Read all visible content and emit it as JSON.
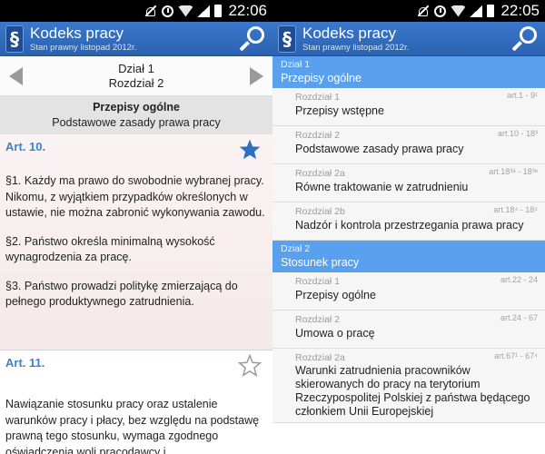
{
  "left": {
    "status_time": "22:06",
    "app": {
      "title": "Kodeks pracy",
      "subtitle": "Stan prawny listopad 2012r.",
      "logo_glyph": "§"
    },
    "division_nav": {
      "division": "Dział 1",
      "chapter": "Rozdział 2"
    },
    "section": {
      "title": "Przepisy ogólne",
      "description": "Podstawowe zasady prawa pracy"
    },
    "articles": [
      {
        "number": "Art. 10.",
        "favorite": true,
        "paragraphs": [
          "§1. Każdy ma prawo do swobodnie wybranej pracy. Nikomu, z wyjątkiem przypadków określonych w ustawie, nie można zabronić wykonywania zawodu.",
          "§2. Państwo określa minimalną wysokość wynagrodzenia za pracę.",
          "§3. Państwo prowadzi politykę zmierzającą do pełnego produktywnego zatrudnienia."
        ]
      },
      {
        "number": "Art. 11.",
        "favorite": false,
        "paragraphs": [
          "Nawiązanie stosunku pracy oraz ustalenie warunków pracy i płacy, bez względu na podstawę prawną tego stosunku, wymaga zgodnego oświadczenia woli pracodawcy i"
        ]
      }
    ]
  },
  "right": {
    "status_time": "22:05",
    "app": {
      "title": "Kodeks pracy",
      "subtitle": "Stan prawny listopad 2012r.",
      "logo_glyph": "§"
    },
    "divisions": [
      {
        "label": "Dział 1",
        "name": "Przepisy ogólne",
        "chapters": [
          {
            "label": "Rozdział 1",
            "name": "Przepisy wstępne",
            "range": "art.1 - 9¹"
          },
          {
            "label": "Rozdział 2",
            "name": "Podstawowe zasady prawa pracy",
            "range": "art.10 - 18³"
          },
          {
            "label": "Rozdział 2a",
            "name": "Równe traktowanie w zatrudnieniu",
            "range": "art.18³ᵃ - 18³ᵉ"
          },
          {
            "label": "Rozdział 2b",
            "name": "Nadzór i kontrola przestrzegania prawa pracy",
            "range": "art.18⁴ - 18⁵"
          }
        ]
      },
      {
        "label": "Dział 2",
        "name": "Stosunek pracy",
        "chapters": [
          {
            "label": "Rozdział 1",
            "name": "Przepisy ogólne",
            "range": "art.22 - 24"
          },
          {
            "label": "Rozdział 2",
            "name": "Umowa o pracę",
            "range": "art.24 - 67"
          },
          {
            "label": "Rozdział 2a",
            "name": "Warunki zatrudnienia pracowników skierowanych do pracy na terytorium Rzeczypospolitej Polskiej z państwa będącego członkiem Unii Europejskiej",
            "range": "art.67¹ - 67⁴"
          }
        ]
      }
    ]
  },
  "colors": {
    "appbar": "#2b62b0",
    "division_header": "#59a0ef",
    "article_number": "#3d7fd0",
    "star_filled": "#2f6fc2"
  }
}
